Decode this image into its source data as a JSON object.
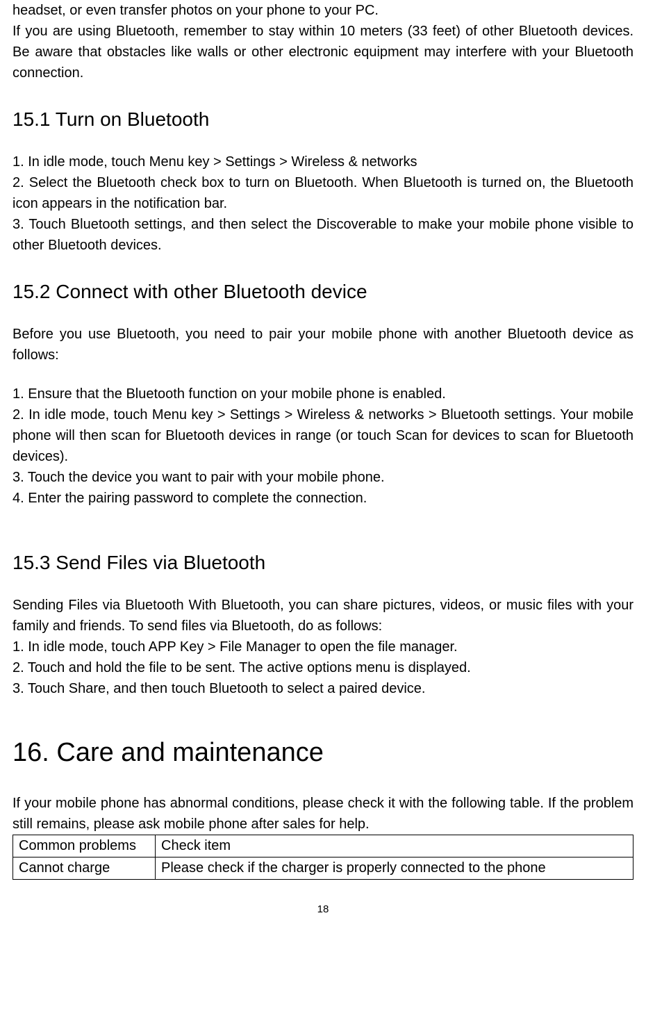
{
  "intro": {
    "p1": "headset, or even transfer photos on your phone to your PC.",
    "p2": "If you are using Bluetooth, remember to stay within 10 meters (33 feet) of other Bluetooth devices. Be aware that obstacles like walls or other electronic equipment may interfere with your Bluetooth connection."
  },
  "s151": {
    "heading": "15.1 Turn on Bluetooth",
    "step1": "1. In idle mode, touch Menu key > Settings > Wireless & networks",
    "step2": "2. Select the Bluetooth check box to turn on Bluetooth. When Bluetooth is turned on, the Bluetooth icon appears in the notification bar.",
    "step3": "3. Touch Bluetooth settings, and then select the Discoverable to make your mobile phone visible to other Bluetooth devices."
  },
  "s152": {
    "heading": "15.2 Connect with other Bluetooth device",
    "intro": "Before you use Bluetooth, you need to pair your mobile phone with another Bluetooth device as follows:",
    "step1": "1. Ensure that the Bluetooth function on your mobile phone is enabled.",
    "step2": "2. In idle mode, touch Menu key > Settings > Wireless & networks > Bluetooth settings. Your mobile phone will then scan for Bluetooth devices in range (or touch Scan for devices to scan for Bluetooth devices).",
    "step3": "3. Touch the device you want to pair with your mobile phone.",
    "step4": "4. Enter the pairing password to complete the connection."
  },
  "s153": {
    "heading": "15.3 Send Files via Bluetooth",
    "intro": "Sending Files via Bluetooth With Bluetooth, you can share pictures, videos, or music files with your family and friends. To send files via Bluetooth, do as follows:",
    "step1": "1. In idle mode, touch APP Key > File Manager to open the file manager.",
    "step2": "2. Touch and hold the file to be sent. The active options menu is displayed.",
    "step3": "3. Touch Share, and then touch Bluetooth to select a paired device."
  },
  "s16": {
    "heading": "16. Care and maintenance",
    "intro": "If your mobile phone has abnormal conditions, please check it with the following table. If the problem still remains, please ask mobile phone after sales for help.",
    "table": {
      "header_col1": "Common problems",
      "header_col2": "Check item",
      "row1_col1": "Cannot charge",
      "row1_col2": "Please check if the charger is properly connected to the phone"
    }
  },
  "page_number": "18"
}
